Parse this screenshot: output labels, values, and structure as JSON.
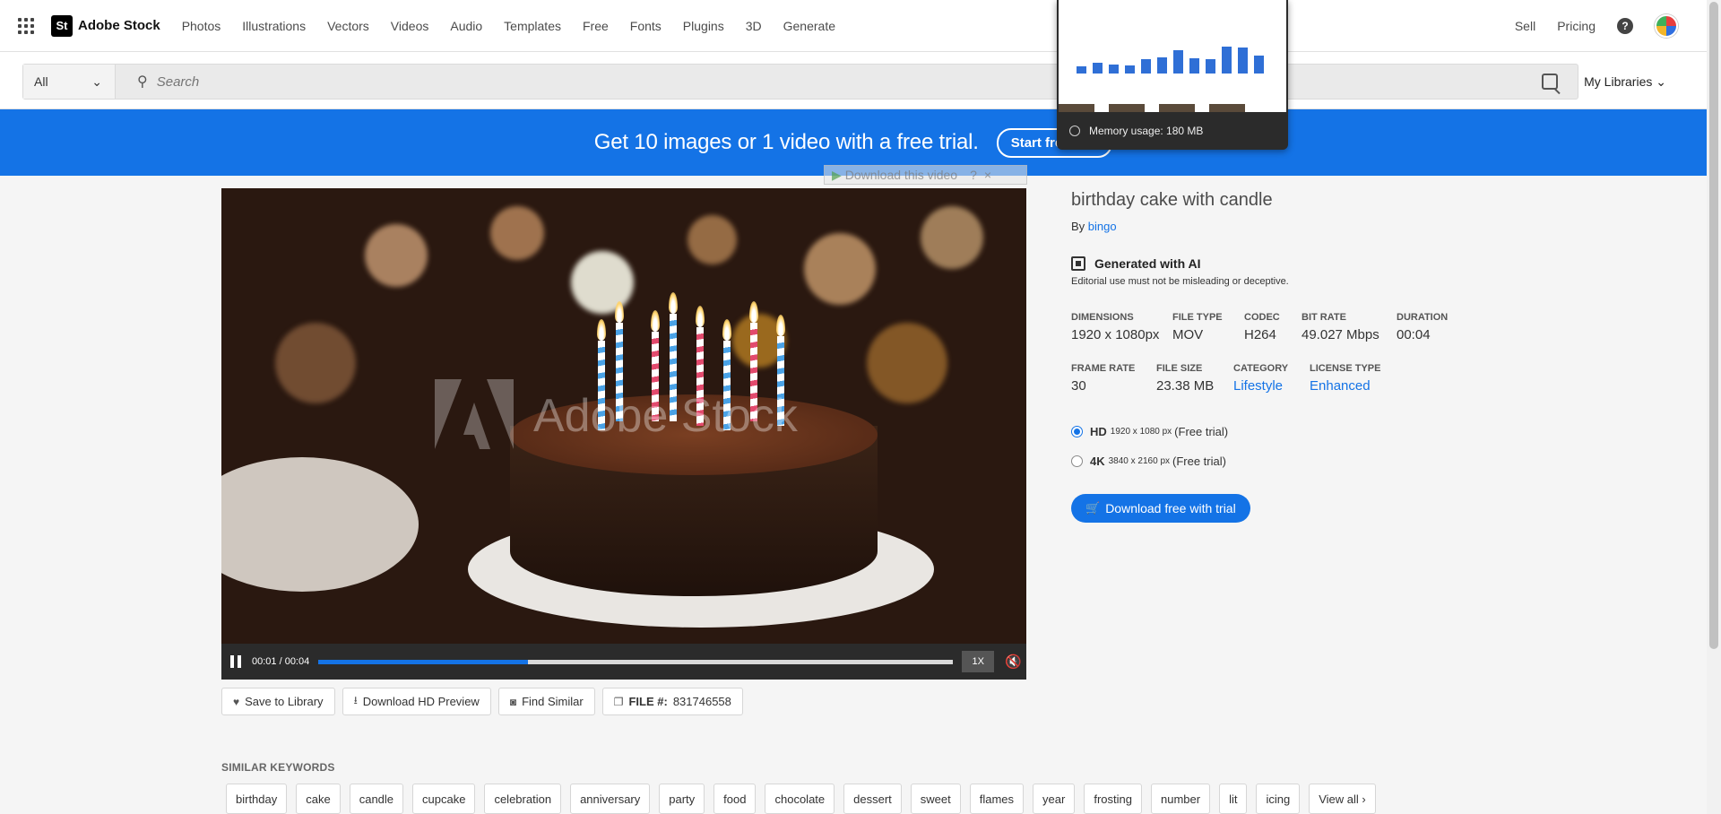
{
  "brand": {
    "logo": "St",
    "name": "Adobe Stock"
  },
  "nav": {
    "links": [
      "Photos",
      "Illustrations",
      "Vectors",
      "Videos",
      "Audio",
      "Templates",
      "Free",
      "Fonts",
      "Plugins",
      "3D",
      "Generate"
    ],
    "sell": "Sell",
    "pricing": "Pricing",
    "help": "?"
  },
  "search": {
    "filter": "All",
    "placeholder": "Search",
    "libraries": "My Libraries"
  },
  "banner": {
    "text": "Get 10 images or 1 video with a free trial.",
    "button": "Start free trial"
  },
  "overlay": {
    "download_video": "Download this video",
    "help": "?",
    "close": "×"
  },
  "player": {
    "time": "00:01 / 00:04",
    "progress": 0.33,
    "speed": "1X",
    "watermark": "Adobe Stock"
  },
  "actions": {
    "save": "Save to Library",
    "download_preview": "Download HD Preview",
    "find_similar": "Find Similar",
    "file_label": "FILE #:",
    "file_number": "831746558"
  },
  "asset": {
    "title": "birthday cake with candle",
    "by": "By",
    "author": "bingo",
    "ai_label": "Generated with AI",
    "ai_note": "Editorial use must not be misleading or deceptive."
  },
  "specs": {
    "dimensions": {
      "k": "DIMENSIONS",
      "v": "1920 x 1080px"
    },
    "file_type": {
      "k": "FILE TYPE",
      "v": "MOV"
    },
    "codec": {
      "k": "CODEC",
      "v": "H264"
    },
    "bit_rate": {
      "k": "BIT RATE",
      "v": "49.027 Mbps"
    },
    "duration": {
      "k": "DURATION",
      "v": "00:04"
    },
    "frame_rate": {
      "k": "FRAME RATE",
      "v": "30"
    },
    "file_size": {
      "k": "FILE SIZE",
      "v": "23.38 MB"
    },
    "category": {
      "k": "CATEGORY",
      "v": "Lifestyle"
    },
    "license_type": {
      "k": "LICENSE TYPE",
      "v": "Enhanced"
    }
  },
  "options": {
    "hd": {
      "label": "HD",
      "px": "1920 x 1080 px",
      "note": "(Free trial)"
    },
    "k4": {
      "label": "4K",
      "px": "3840 x 2160 px",
      "note": "(Free trial)"
    },
    "download": "Download free with trial"
  },
  "keywords": {
    "title": "SIMILAR KEYWORDS",
    "items": [
      "birthday",
      "cake",
      "candle",
      "cupcake",
      "celebration",
      "anniversary",
      "party",
      "food",
      "chocolate",
      "dessert",
      "sweet",
      "flames",
      "year",
      "frosting",
      "number",
      "lit",
      "icing"
    ],
    "view_all": "View all ›"
  },
  "memory": {
    "text": "Memory usage: 180 MB"
  },
  "colors": {
    "accent": "#1473e6",
    "banner": "#1473e6",
    "control_bar": "#2b2b2b"
  }
}
